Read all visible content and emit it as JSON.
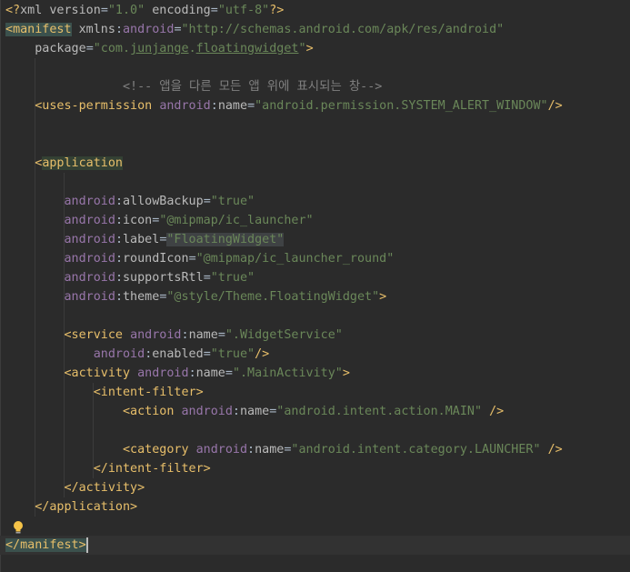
{
  "editor": {
    "lines": [
      {
        "tokens": [
          {
            "t": "<?",
            "c": "c-pre"
          },
          {
            "t": "xml version",
            "c": "c-attr"
          },
          {
            "t": "=",
            "c": "c-text"
          },
          {
            "t": "\"1.0\"",
            "c": "c-val"
          },
          {
            "t": " encoding",
            "c": "c-attr"
          },
          {
            "t": "=",
            "c": "c-text"
          },
          {
            "t": "\"utf-8\"",
            "c": "c-val"
          },
          {
            "t": "?>",
            "c": "c-pre"
          }
        ]
      },
      {
        "tokens": [
          {
            "t": "<",
            "c": "c-tag hl-tag"
          },
          {
            "t": "manifest",
            "c": "c-tag hl-tag"
          },
          {
            "t": " xmlns",
            "c": "c-attr"
          },
          {
            "t": ":",
            "c": "c-text"
          },
          {
            "t": "android",
            "c": "c-ns"
          },
          {
            "t": "=",
            "c": "c-text"
          },
          {
            "t": "\"http://schemas.android.com/apk/res/android\"",
            "c": "c-val"
          }
        ]
      },
      {
        "tokens": [
          {
            "t": "    package",
            "c": "c-attr"
          },
          {
            "t": "=",
            "c": "c-text"
          },
          {
            "t": "\"com.",
            "c": "c-val"
          },
          {
            "t": "junjange",
            "c": "c-val",
            "u": true
          },
          {
            "t": ".",
            "c": "c-val"
          },
          {
            "t": "floatingwidget",
            "c": "c-val",
            "u": true
          },
          {
            "t": "\"",
            "c": "c-val"
          },
          {
            "t": ">",
            "c": "c-tag"
          }
        ]
      },
      {
        "tokens": []
      },
      {
        "tokens": [
          {
            "t": "                <!-- 앱을 다른 모든 앱 위에 표시되는 창-->",
            "c": "c-com"
          }
        ]
      },
      {
        "tokens": [
          {
            "t": "    <uses-permission ",
            "c": "c-tag"
          },
          {
            "t": "android",
            "c": "c-ns"
          },
          {
            "t": ":",
            "c": "c-text"
          },
          {
            "t": "name",
            "c": "c-attr"
          },
          {
            "t": "=",
            "c": "c-text"
          },
          {
            "t": "\"android.permission.SYSTEM_ALERT_WINDOW\"",
            "c": "c-val"
          },
          {
            "t": "/>",
            "c": "c-tag"
          }
        ]
      },
      {
        "tokens": []
      },
      {
        "tokens": []
      },
      {
        "tokens": [
          {
            "t": "    <",
            "c": "c-tag"
          },
          {
            "t": "application",
            "c": "c-tag hl-app"
          }
        ]
      },
      {
        "tokens": []
      },
      {
        "tokens": [
          {
            "t": "        android",
            "c": "c-ns"
          },
          {
            "t": ":",
            "c": "c-text"
          },
          {
            "t": "allowBackup",
            "c": "c-attr"
          },
          {
            "t": "=",
            "c": "c-text"
          },
          {
            "t": "\"true\"",
            "c": "c-val"
          }
        ]
      },
      {
        "tokens": [
          {
            "t": "        android",
            "c": "c-ns"
          },
          {
            "t": ":",
            "c": "c-text"
          },
          {
            "t": "icon",
            "c": "c-attr"
          },
          {
            "t": "=",
            "c": "c-text"
          },
          {
            "t": "\"@mipmap/ic_launcher\"",
            "c": "c-val"
          }
        ]
      },
      {
        "tokens": [
          {
            "t": "        android",
            "c": "c-ns"
          },
          {
            "t": ":",
            "c": "c-text"
          },
          {
            "t": "label",
            "c": "c-attr"
          },
          {
            "t": "=",
            "c": "c-text"
          },
          {
            "t": "\"FloatingWidget\"",
            "c": "c-val hl-val"
          }
        ]
      },
      {
        "tokens": [
          {
            "t": "        android",
            "c": "c-ns"
          },
          {
            "t": ":",
            "c": "c-text"
          },
          {
            "t": "roundIcon",
            "c": "c-attr"
          },
          {
            "t": "=",
            "c": "c-text"
          },
          {
            "t": "\"@mipmap/ic_launcher_round\"",
            "c": "c-val"
          }
        ]
      },
      {
        "tokens": [
          {
            "t": "        android",
            "c": "c-ns"
          },
          {
            "t": ":",
            "c": "c-text"
          },
          {
            "t": "supportsRtl",
            "c": "c-attr"
          },
          {
            "t": "=",
            "c": "c-text"
          },
          {
            "t": "\"true\"",
            "c": "c-val"
          }
        ]
      },
      {
        "tokens": [
          {
            "t": "        android",
            "c": "c-ns"
          },
          {
            "t": ":",
            "c": "c-text"
          },
          {
            "t": "theme",
            "c": "c-attr"
          },
          {
            "t": "=",
            "c": "c-text"
          },
          {
            "t": "\"@style/Theme.FloatingWidget\"",
            "c": "c-val"
          },
          {
            "t": ">",
            "c": "c-tag"
          }
        ]
      },
      {
        "tokens": []
      },
      {
        "tokens": [
          {
            "t": "        <service ",
            "c": "c-tag"
          },
          {
            "t": "android",
            "c": "c-ns"
          },
          {
            "t": ":",
            "c": "c-text"
          },
          {
            "t": "name",
            "c": "c-attr"
          },
          {
            "t": "=",
            "c": "c-text"
          },
          {
            "t": "\".WidgetService\"",
            "c": "c-val"
          }
        ]
      },
      {
        "tokens": [
          {
            "t": "            android",
            "c": "c-ns"
          },
          {
            "t": ":",
            "c": "c-text"
          },
          {
            "t": "enabled",
            "c": "c-attr"
          },
          {
            "t": "=",
            "c": "c-text"
          },
          {
            "t": "\"true\"",
            "c": "c-val"
          },
          {
            "t": "/>",
            "c": "c-tag"
          }
        ]
      },
      {
        "tokens": [
          {
            "t": "        <activity ",
            "c": "c-tag"
          },
          {
            "t": "android",
            "c": "c-ns"
          },
          {
            "t": ":",
            "c": "c-text"
          },
          {
            "t": "name",
            "c": "c-attr"
          },
          {
            "t": "=",
            "c": "c-text"
          },
          {
            "t": "\".MainActivity\"",
            "c": "c-val"
          },
          {
            "t": ">",
            "c": "c-tag"
          }
        ]
      },
      {
        "tokens": [
          {
            "t": "            <intent-filter>",
            "c": "c-tag"
          }
        ]
      },
      {
        "tokens": [
          {
            "t": "                <action ",
            "c": "c-tag"
          },
          {
            "t": "android",
            "c": "c-ns"
          },
          {
            "t": ":",
            "c": "c-text"
          },
          {
            "t": "name",
            "c": "c-attr"
          },
          {
            "t": "=",
            "c": "c-text"
          },
          {
            "t": "\"android.intent.action.MAIN\"",
            "c": "c-val"
          },
          {
            "t": " />",
            "c": "c-tag"
          }
        ]
      },
      {
        "tokens": []
      },
      {
        "tokens": [
          {
            "t": "                <category ",
            "c": "c-tag"
          },
          {
            "t": "android",
            "c": "c-ns"
          },
          {
            "t": ":",
            "c": "c-text"
          },
          {
            "t": "name",
            "c": "c-attr"
          },
          {
            "t": "=",
            "c": "c-text"
          },
          {
            "t": "\"android.intent.category.LAUNCHER\"",
            "c": "c-val"
          },
          {
            "t": " />",
            "c": "c-tag"
          }
        ]
      },
      {
        "tokens": [
          {
            "t": "            </intent-filter>",
            "c": "c-tag"
          }
        ]
      },
      {
        "tokens": [
          {
            "t": "        </activity>",
            "c": "c-tag"
          }
        ]
      },
      {
        "tokens": [
          {
            "t": "    </application>",
            "c": "c-tag"
          }
        ]
      },
      {
        "tokens": []
      },
      {
        "tokens": [
          {
            "t": "</",
            "c": "c-tag hl-tag"
          },
          {
            "t": "manifest",
            "c": "c-tag hl-tag"
          },
          {
            "t": ">",
            "c": "c-tag hl-tag"
          }
        ],
        "current": true
      }
    ],
    "intention_icon": "lightbulb-icon"
  }
}
